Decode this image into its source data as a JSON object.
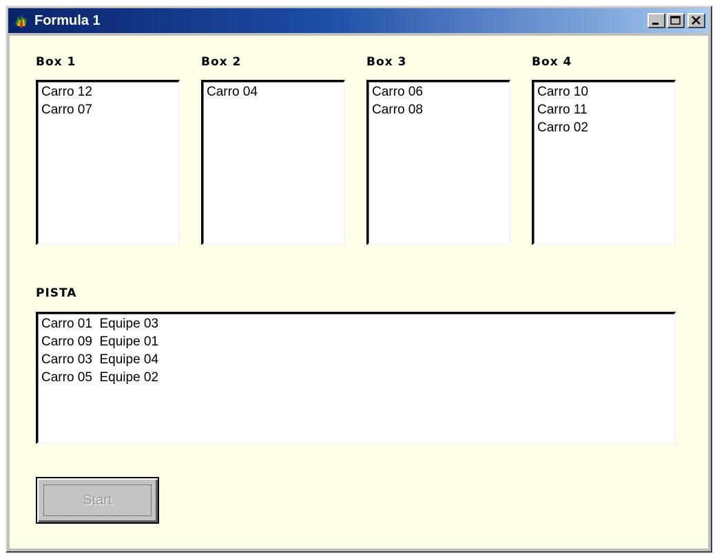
{
  "window": {
    "title": "Formula 1",
    "app_icon": "formula-car-icon",
    "controls": {
      "minimize_icon": "minimize-icon",
      "maximize_icon": "maximize-icon",
      "close_icon": "close-icon"
    }
  },
  "boxes": [
    {
      "label": "Box 1",
      "items": [
        "Carro 12",
        "Carro 07"
      ]
    },
    {
      "label": "Box 2",
      "items": [
        "Carro 04"
      ]
    },
    {
      "label": "Box 3",
      "items": [
        "Carro 06",
        "Carro 08"
      ]
    },
    {
      "label": "Box 4",
      "items": [
        "Carro 10",
        "Carro 11",
        "Carro 02"
      ]
    }
  ],
  "pista": {
    "label": "PISTA",
    "items": [
      "Carro 01  Equipe 03",
      "Carro 09  Equipe 01",
      "Carro 03  Equipe 04",
      "Carro 05  Equipe 02"
    ]
  },
  "start_button": {
    "label": "Start",
    "enabled": false
  },
  "colors": {
    "client_background": "#ffffe8",
    "titlebar_start": "#0a246a",
    "titlebar_end": "#a6caf0",
    "disabled_text": "#9a9a9a"
  }
}
